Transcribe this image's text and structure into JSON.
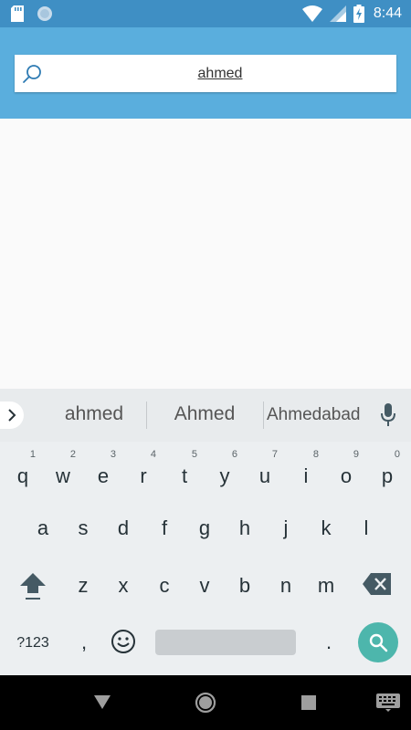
{
  "status_bar": {
    "time": "8:44"
  },
  "search": {
    "value": "ahmed"
  },
  "keyboard": {
    "suggestions": [
      "ahmed",
      "Ahmed",
      "Ahmedabad"
    ],
    "row1": [
      {
        "ch": "q",
        "hint": "1"
      },
      {
        "ch": "w",
        "hint": "2"
      },
      {
        "ch": "e",
        "hint": "3"
      },
      {
        "ch": "r",
        "hint": "4"
      },
      {
        "ch": "t",
        "hint": "5"
      },
      {
        "ch": "y",
        "hint": "6"
      },
      {
        "ch": "u",
        "hint": "7"
      },
      {
        "ch": "i",
        "hint": "8"
      },
      {
        "ch": "o",
        "hint": "9"
      },
      {
        "ch": "p",
        "hint": "0"
      }
    ],
    "row2": [
      "a",
      "s",
      "d",
      "f",
      "g",
      "h",
      "j",
      "k",
      "l"
    ],
    "row3": [
      "z",
      "x",
      "c",
      "v",
      "b",
      "n",
      "m"
    ],
    "symbols_label": "?123",
    "comma": ",",
    "period": "."
  },
  "colors": {
    "status_bar": "#3f8fc4",
    "app_bar": "#5aaedd",
    "search_action": "#4db6ac"
  }
}
